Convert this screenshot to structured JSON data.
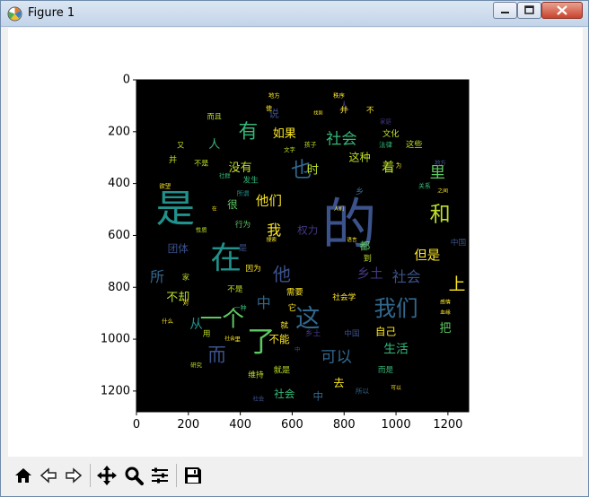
{
  "window": {
    "title": "Figure 1"
  },
  "toolbar": {
    "buttons": [
      {
        "name": "home-icon",
        "label": "Home"
      },
      {
        "name": "back-icon",
        "label": "Back"
      },
      {
        "name": "forward-icon",
        "label": "Forward"
      },
      {
        "name": "pan-icon",
        "label": "Pan"
      },
      {
        "name": "zoom-icon",
        "label": "Zoom"
      },
      {
        "name": "subplots-icon",
        "label": "Subplots"
      },
      {
        "name": "save-icon",
        "label": "Save"
      }
    ]
  },
  "chart_data": {
    "type": "wordcloud",
    "xlim": [
      0,
      1280
    ],
    "ylim": [
      1280,
      0
    ],
    "xticks": [
      0,
      200,
      400,
      600,
      800,
      1000,
      1200
    ],
    "yticks": [
      0,
      200,
      400,
      600,
      800,
      1000,
      1200
    ],
    "background": "#000000",
    "words": [
      {
        "text": "的",
        "x": 820,
        "y": 560,
        "size": 210,
        "color": "#3b528b"
      },
      {
        "text": "是",
        "x": 150,
        "y": 500,
        "size": 150,
        "color": "#21918c"
      },
      {
        "text": "在",
        "x": 345,
        "y": 690,
        "size": 120,
        "color": "#21918c"
      },
      {
        "text": "了",
        "x": 480,
        "y": 1010,
        "size": 110,
        "color": "#5ec962"
      },
      {
        "text": "这",
        "x": 660,
        "y": 920,
        "size": 95,
        "color": "#31688e"
      },
      {
        "text": "我们",
        "x": 1000,
        "y": 880,
        "size": 85,
        "color": "#31688e"
      },
      {
        "text": "一个",
        "x": 330,
        "y": 920,
        "size": 85,
        "color": "#5ec962"
      },
      {
        "text": "和",
        "x": 1170,
        "y": 520,
        "size": 80,
        "color": "#bddf26"
      },
      {
        "text": "有",
        "x": 430,
        "y": 200,
        "size": 75,
        "color": "#35b779"
      },
      {
        "text": "也",
        "x": 635,
        "y": 350,
        "size": 80,
        "color": "#31688e"
      },
      {
        "text": "社会",
        "x": 790,
        "y": 230,
        "size": 60,
        "color": "#35b779"
      },
      {
        "text": "里",
        "x": 1160,
        "y": 360,
        "size": 60,
        "color": "#5ec962"
      },
      {
        "text": "上",
        "x": 1235,
        "y": 790,
        "size": 65,
        "color": "#fde725"
      },
      {
        "text": "他们",
        "x": 510,
        "y": 470,
        "size": 50,
        "color": "#fde725"
      },
      {
        "text": "他",
        "x": 560,
        "y": 750,
        "size": 70,
        "color": "#3b528b"
      },
      {
        "text": "而",
        "x": 310,
        "y": 1060,
        "size": 70,
        "color": "#3b528b"
      },
      {
        "text": "可以",
        "x": 770,
        "y": 1070,
        "size": 60,
        "color": "#31688e"
      },
      {
        "text": "但是",
        "x": 1120,
        "y": 680,
        "size": 50,
        "color": "#fde725"
      },
      {
        "text": "社会",
        "x": 1040,
        "y": 760,
        "size": 55,
        "color": "#3b528b"
      },
      {
        "text": "乡土",
        "x": 900,
        "y": 750,
        "size": 50,
        "color": "#443983"
      },
      {
        "text": "如果",
        "x": 570,
        "y": 210,
        "size": 45,
        "color": "#fde725"
      },
      {
        "text": "没有",
        "x": 400,
        "y": 340,
        "size": 45,
        "color": "#bddf26"
      },
      {
        "text": "不却",
        "x": 160,
        "y": 840,
        "size": 45,
        "color": "#bddf26"
      },
      {
        "text": "从",
        "x": 230,
        "y": 945,
        "size": 50,
        "color": "#21918c"
      },
      {
        "text": "中",
        "x": 490,
        "y": 860,
        "size": 55,
        "color": "#31688e"
      },
      {
        "text": "我",
        "x": 530,
        "y": 580,
        "size": 55,
        "color": "#fde725"
      },
      {
        "text": "生活",
        "x": 1000,
        "y": 1040,
        "size": 48,
        "color": "#35b779"
      },
      {
        "text": "自己",
        "x": 960,
        "y": 970,
        "size": 40,
        "color": "#fde725"
      },
      {
        "text": "着",
        "x": 970,
        "y": 340,
        "size": 50,
        "color": "#bddf26"
      },
      {
        "text": "这种",
        "x": 860,
        "y": 300,
        "size": 42,
        "color": "#bddf26"
      },
      {
        "text": "时",
        "x": 680,
        "y": 350,
        "size": 45,
        "color": "#bddf26"
      },
      {
        "text": "去",
        "x": 780,
        "y": 1170,
        "size": 42,
        "color": "#fde725"
      },
      {
        "text": "社会",
        "x": 570,
        "y": 1210,
        "size": 40,
        "color": "#35b779"
      },
      {
        "text": "都",
        "x": 880,
        "y": 640,
        "size": 40,
        "color": "#5ec962"
      },
      {
        "text": "把",
        "x": 1190,
        "y": 960,
        "size": 45,
        "color": "#5ec962"
      },
      {
        "text": "中",
        "x": 700,
        "y": 1220,
        "size": 40,
        "color": "#31688e"
      },
      {
        "text": "人",
        "x": 300,
        "y": 250,
        "size": 45,
        "color": "#35b779"
      },
      {
        "text": "所",
        "x": 80,
        "y": 760,
        "size": 55,
        "color": "#31688e"
      },
      {
        "text": "团体",
        "x": 160,
        "y": 650,
        "size": 40,
        "color": "#3b528b"
      },
      {
        "text": "权力",
        "x": 660,
        "y": 580,
        "size": 40,
        "color": "#443983"
      },
      {
        "text": "不是",
        "x": 250,
        "y": 320,
        "size": 28,
        "color": "#bddf26"
      },
      {
        "text": "很",
        "x": 370,
        "y": 480,
        "size": 40,
        "color": "#5ec962"
      },
      {
        "text": "行为",
        "x": 410,
        "y": 560,
        "size": 30,
        "color": "#5ec962"
      },
      {
        "text": "说",
        "x": 530,
        "y": 130,
        "size": 40,
        "color": "#3b528b"
      },
      {
        "text": "人",
        "x": 800,
        "y": 100,
        "size": 40,
        "color": "#443983"
      },
      {
        "text": "文化",
        "x": 980,
        "y": 210,
        "size": 32,
        "color": "#bddf26"
      },
      {
        "text": "这些",
        "x": 1070,
        "y": 250,
        "size": 32,
        "color": "#bddf26"
      },
      {
        "text": "法律",
        "x": 960,
        "y": 250,
        "size": 26,
        "color": "#35b779"
      },
      {
        "text": "发生",
        "x": 440,
        "y": 390,
        "size": 30,
        "color": "#35b779"
      },
      {
        "text": "不能",
        "x": 550,
        "y": 1000,
        "size": 40,
        "color": "#fde725"
      },
      {
        "text": "就是",
        "x": 560,
        "y": 1120,
        "size": 32,
        "color": "#bddf26"
      },
      {
        "text": "维持",
        "x": 460,
        "y": 1140,
        "size": 30,
        "color": "#bddf26"
      },
      {
        "text": "社会学",
        "x": 800,
        "y": 840,
        "size": 30,
        "color": "#fde725"
      },
      {
        "text": "需要",
        "x": 610,
        "y": 820,
        "size": 32,
        "color": "#fde725"
      },
      {
        "text": "因为",
        "x": 450,
        "y": 730,
        "size": 30,
        "color": "#fde725"
      },
      {
        "text": "不是",
        "x": 380,
        "y": 810,
        "size": 30,
        "color": "#bddf26"
      },
      {
        "text": "而是",
        "x": 960,
        "y": 1120,
        "size": 30,
        "color": "#35b779"
      },
      {
        "text": "到",
        "x": 890,
        "y": 690,
        "size": 32,
        "color": "#bddf26"
      },
      {
        "text": "中国",
        "x": 830,
        "y": 980,
        "size": 30,
        "color": "#3b528b"
      },
      {
        "text": "乡土",
        "x": 680,
        "y": 980,
        "size": 30,
        "color": "#443983"
      },
      {
        "text": "就",
        "x": 570,
        "y": 950,
        "size": 30,
        "color": "#fde725"
      },
      {
        "text": "并",
        "x": 800,
        "y": 120,
        "size": 30,
        "color": "#fde725"
      },
      {
        "text": "不",
        "x": 900,
        "y": 120,
        "size": 30,
        "color": "#fde725"
      },
      {
        "text": "而且",
        "x": 300,
        "y": 140,
        "size": 28,
        "color": "#bddf26"
      },
      {
        "text": "又",
        "x": 170,
        "y": 250,
        "size": 28,
        "color": "#bddf26"
      },
      {
        "text": "并",
        "x": 140,
        "y": 310,
        "size": 32,
        "color": "#bddf26"
      },
      {
        "text": "家",
        "x": 190,
        "y": 760,
        "size": 28,
        "color": "#bddf26"
      },
      {
        "text": "所以",
        "x": 870,
        "y": 1200,
        "size": 26,
        "color": "#31688e"
      },
      {
        "text": "中国",
        "x": 1240,
        "y": 630,
        "size": 30,
        "color": "#3b528b"
      },
      {
        "text": "关系",
        "x": 1110,
        "y": 410,
        "size": 24,
        "color": "#35b779"
      },
      {
        "text": "秩序",
        "x": 780,
        "y": 60,
        "size": 22,
        "color": "#fde725"
      },
      {
        "text": "地方",
        "x": 530,
        "y": 60,
        "size": 22,
        "color": "#fde725"
      },
      {
        "text": "孩子",
        "x": 670,
        "y": 250,
        "size": 24,
        "color": "#bddf26"
      },
      {
        "text": "用",
        "x": 270,
        "y": 980,
        "size": 30,
        "color": "#bddf26"
      },
      {
        "text": "什么",
        "x": 120,
        "y": 930,
        "size": 22,
        "color": "#fde725"
      },
      {
        "text": "性质",
        "x": 250,
        "y": 580,
        "size": 22,
        "color": "#bddf26"
      },
      {
        "text": "所谓",
        "x": 410,
        "y": 440,
        "size": 24,
        "color": "#21918c"
      },
      {
        "text": "它",
        "x": 600,
        "y": 880,
        "size": 32,
        "color": "#fde725"
      },
      {
        "text": "是",
        "x": 410,
        "y": 650,
        "size": 32,
        "color": "#3b528b"
      },
      {
        "text": "乡",
        "x": 860,
        "y": 430,
        "size": 32,
        "color": "#31688e"
      },
      {
        "text": "研究",
        "x": 230,
        "y": 1100,
        "size": 22,
        "color": "#bddf26"
      },
      {
        "text": "一种",
        "x": 400,
        "y": 880,
        "size": 24,
        "color": "#35b779"
      },
      {
        "text": "感情",
        "x": 1190,
        "y": 860,
        "size": 20,
        "color": "#fde725"
      },
      {
        "text": "血缘",
        "x": 1190,
        "y": 900,
        "size": 20,
        "color": "#fde725"
      },
      {
        "text": "欲望",
        "x": 110,
        "y": 410,
        "size": 22,
        "color": "#fde725"
      },
      {
        "text": "社群",
        "x": 340,
        "y": 370,
        "size": 22,
        "color": "#35b779"
      },
      {
        "text": "文字",
        "x": 590,
        "y": 270,
        "size": 22,
        "color": "#bddf26"
      },
      {
        "text": "人们",
        "x": 780,
        "y": 500,
        "size": 20,
        "color": "#fde725"
      },
      {
        "text": "搜索",
        "x": 520,
        "y": 620,
        "size": 20,
        "color": "#fde725"
      },
      {
        "text": "对",
        "x": 190,
        "y": 860,
        "size": 24,
        "color": "#fde725"
      },
      {
        "text": "在",
        "x": 300,
        "y": 500,
        "size": 20,
        "color": "#fde725"
      },
      {
        "text": "可以",
        "x": 1000,
        "y": 1190,
        "size": 20,
        "color": "#fde725"
      },
      {
        "text": "里",
        "x": 390,
        "y": 1000,
        "size": 22,
        "color": "#fde725"
      },
      {
        "text": "社会",
        "x": 360,
        "y": 1000,
        "size": 20,
        "color": "#fde725"
      },
      {
        "text": "为",
        "x": 1010,
        "y": 330,
        "size": 22,
        "color": "#fde725"
      },
      {
        "text": "之间",
        "x": 1180,
        "y": 430,
        "size": 20,
        "color": "#fde725"
      },
      {
        "text": "语言",
        "x": 830,
        "y": 620,
        "size": 20,
        "color": "#fde725"
      },
      {
        "text": "使",
        "x": 510,
        "y": 110,
        "size": 24,
        "color": "#fde725"
      },
      {
        "text": "找到",
        "x": 700,
        "y": 130,
        "size": 18,
        "color": "#fde725"
      },
      {
        "text": "家庭",
        "x": 960,
        "y": 160,
        "size": 22,
        "color": "#443983"
      },
      {
        "text": "地方",
        "x": 1170,
        "y": 320,
        "size": 22,
        "color": "#3b528b"
      },
      {
        "text": "社会",
        "x": 470,
        "y": 1230,
        "size": 22,
        "color": "#3b528b"
      },
      {
        "text": "中",
        "x": 620,
        "y": 1040,
        "size": 22,
        "color": "#3b528b"
      }
    ]
  }
}
